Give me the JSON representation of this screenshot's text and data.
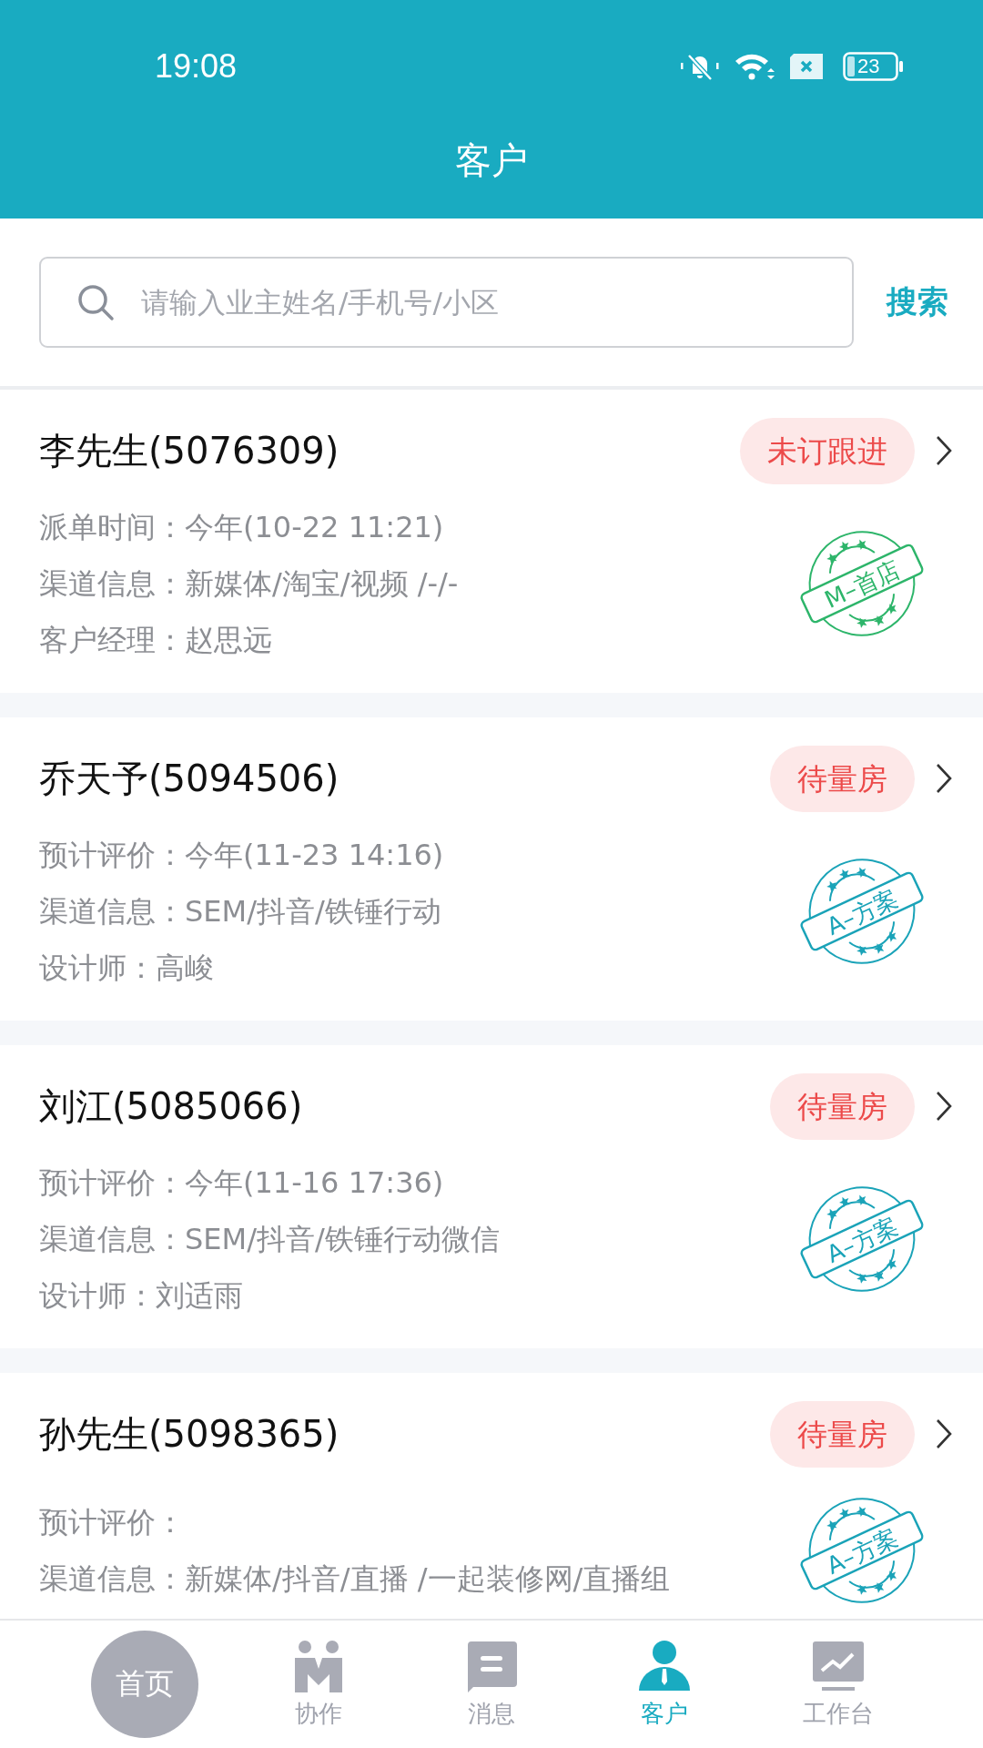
{
  "status_bar": {
    "time": "19:08",
    "battery": "23"
  },
  "header": {
    "title": "客户"
  },
  "search": {
    "placeholder": "请输入业主姓名/手机号/小区",
    "button": "搜索"
  },
  "customers": [
    {
      "name": "李先生(5076309)",
      "badge": "未订跟进",
      "lines": [
        "派单时间：今年(10-22 11:21)",
        "渠道信息：新媒体/淘宝/视频 /-/-",
        "客户经理：赵思远"
      ],
      "stamp": {
        "text": "M–首店",
        "color": "#2db56a"
      }
    },
    {
      "name": "乔天予(5094506)",
      "badge": "待量房",
      "lines": [
        "预计评价：今年(11-23 14:16)",
        "渠道信息：SEM/抖音/铁锤行动",
        "设计师：高峻"
      ],
      "stamp": {
        "text": "A–方案",
        "color": "#1aa3b8"
      }
    },
    {
      "name": "刘江(5085066)",
      "badge": "待量房",
      "lines": [
        "预计评价：今年(11-16 17:36)",
        "渠道信息：SEM/抖音/铁锤行动微信",
        "设计师：刘适雨"
      ],
      "stamp": {
        "text": "A–方案",
        "color": "#1aa3b8"
      }
    },
    {
      "name": "孙先生(5098365)",
      "badge": "待量房",
      "lines": [
        "预计评价：",
        "渠道信息：新媒体/抖音/直播 /一起装修网/直播组"
      ],
      "stamp": {
        "text": "A–方案",
        "color": "#1aa3b8"
      }
    }
  ],
  "nav": [
    {
      "label": "首页",
      "kind": "circle",
      "selected": false
    },
    {
      "label": "协作",
      "kind": "team",
      "selected": false
    },
    {
      "label": "消息",
      "kind": "message",
      "selected": false
    },
    {
      "label": "客户",
      "kind": "person",
      "selected": true
    },
    {
      "label": "工作台",
      "kind": "chart",
      "selected": false
    }
  ]
}
